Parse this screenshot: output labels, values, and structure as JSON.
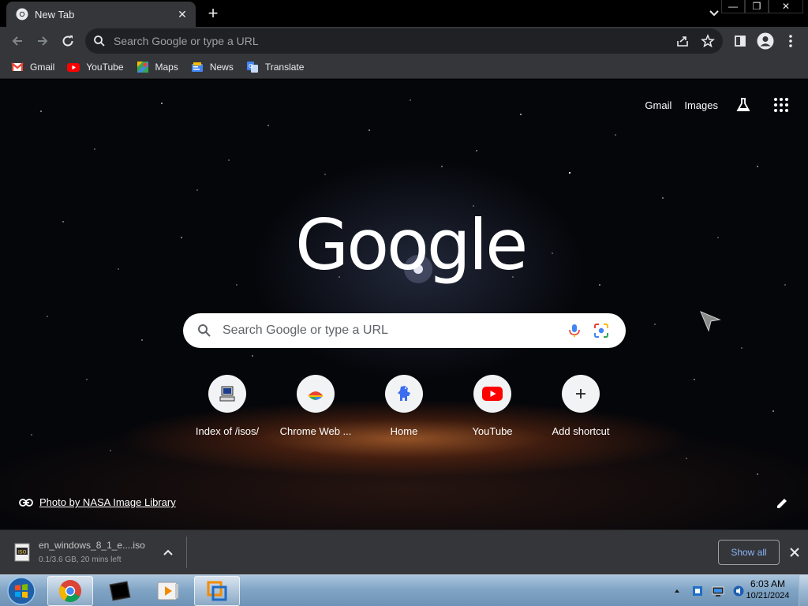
{
  "tab": {
    "title": "New Tab",
    "favicon": "chrome-icon"
  },
  "toolbar": {
    "omnibox_placeholder": "Search Google or type a URL"
  },
  "bookmarks": [
    {
      "label": "Gmail",
      "icon": "gmail-icon"
    },
    {
      "label": "YouTube",
      "icon": "youtube-icon"
    },
    {
      "label": "Maps",
      "icon": "maps-icon"
    },
    {
      "label": "News",
      "icon": "news-icon"
    },
    {
      "label": "Translate",
      "icon": "translate-icon"
    }
  ],
  "ntp": {
    "links": {
      "gmail": "Gmail",
      "images": "Images"
    },
    "logo": "Google",
    "search_placeholder": "Search Google or type a URL",
    "shortcuts": [
      {
        "label": "Index of /isos/",
        "icon": "computer-icon"
      },
      {
        "label": "Chrome Web ...",
        "icon": "chrome-web-store-icon"
      },
      {
        "label": "Home",
        "icon": "home-dino-icon"
      },
      {
        "label": "YouTube",
        "icon": "youtube-icon"
      },
      {
        "label": "Add shortcut",
        "icon": "plus-icon"
      }
    ],
    "photo_credit": "Photo by NASA Image Library"
  },
  "download": {
    "filename": "en_windows_8_1_e....iso",
    "status": "0.1/3.6 GB, 20 mins left",
    "show_all": "Show all"
  },
  "taskbar": {
    "time": "6:03 AM",
    "date": "10/21/2024"
  },
  "colors": {
    "chrome_frame": "#000000",
    "toolbar": "#35363a",
    "omnibox": "#202124",
    "link_blue": "#8ab4f8"
  }
}
